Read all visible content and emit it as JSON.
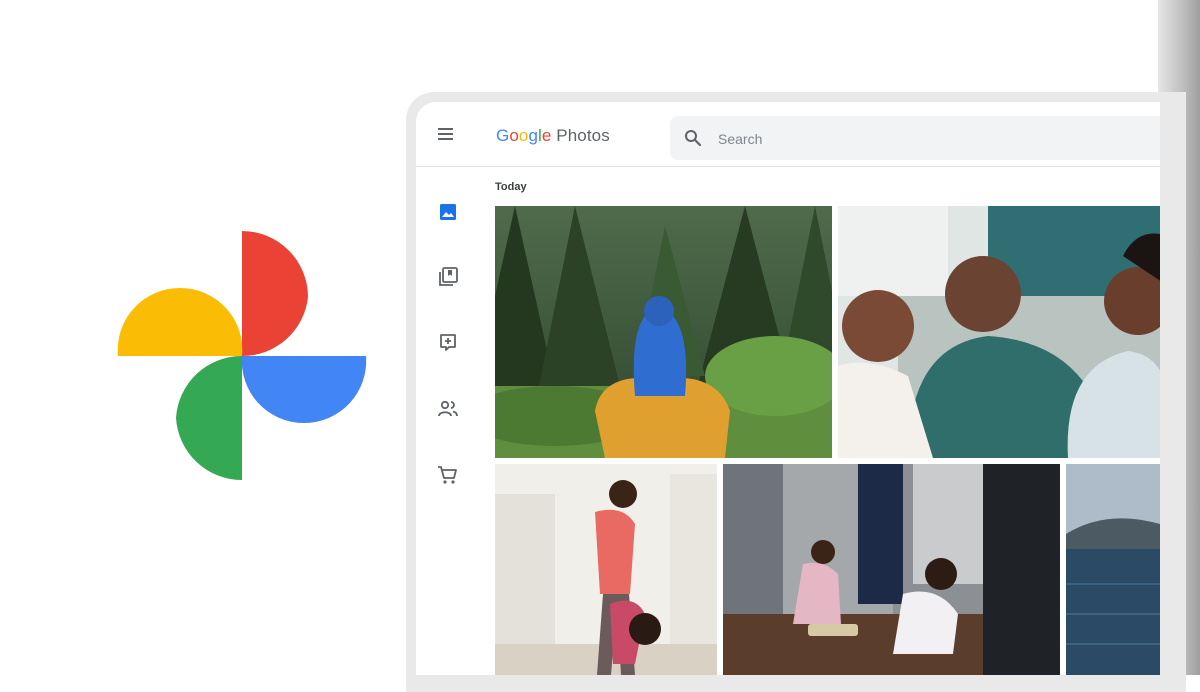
{
  "app": {
    "brand_google": [
      "G",
      "o",
      "o",
      "g",
      "l",
      "e"
    ],
    "brand_product": "Photos"
  },
  "search": {
    "placeholder": "Search"
  },
  "sidebar": {
    "items": [
      {
        "icon": "photos-icon",
        "active": true
      },
      {
        "icon": "albums-icon",
        "active": false
      },
      {
        "icon": "for-you-icon",
        "active": false
      },
      {
        "icon": "sharing-icon",
        "active": false
      },
      {
        "icon": "print-store-icon",
        "active": false
      }
    ]
  },
  "main": {
    "section_title": "Today"
  },
  "photos": [
    {
      "subject": "child-on-shoulders-forest"
    },
    {
      "subject": "family-laughing-couch"
    },
    {
      "subject": "mother-daughter-yoga"
    },
    {
      "subject": "kids-playing-kitchen-floor"
    },
    {
      "subject": "lake-view"
    }
  ],
  "colors": {
    "google_blue": "#4285F4",
    "google_red": "#EA4335",
    "google_yellow": "#FBBC05",
    "google_green": "#34A853",
    "active_nav": "#1a73e8"
  }
}
